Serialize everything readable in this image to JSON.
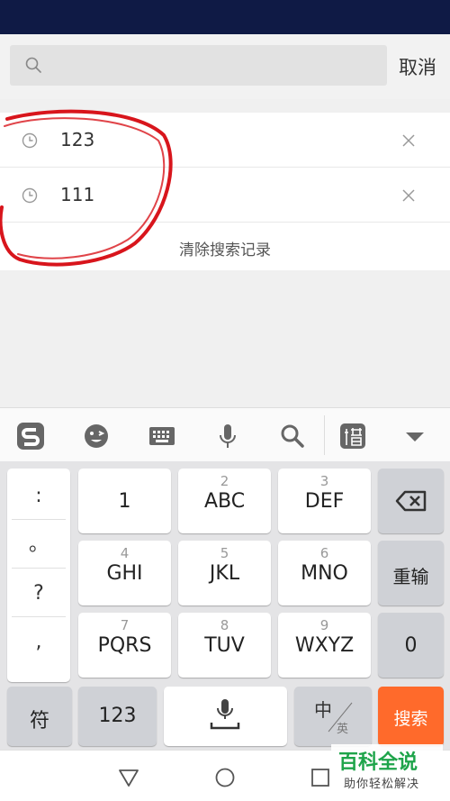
{
  "search": {
    "placeholder": "",
    "cancel_label": "取消"
  },
  "history": {
    "items": [
      {
        "text": "123"
      },
      {
        "text": "111"
      }
    ],
    "clear_label": "清除搜索记录"
  },
  "keyboard": {
    "toolbar_icons": [
      "sogou-logo-icon",
      "emoji-icon",
      "keyboard-icon",
      "microphone-icon",
      "search-icon",
      "clipboard-icon",
      "collapse-icon"
    ],
    "punctuation": [
      ":",
      "。",
      "?",
      ","
    ],
    "keys_row1": [
      {
        "num": "",
        "label": "1"
      },
      {
        "num": "2",
        "label": "ABC"
      },
      {
        "num": "3",
        "label": "DEF"
      }
    ],
    "keys_row2": [
      {
        "num": "4",
        "label": "GHI"
      },
      {
        "num": "5",
        "label": "JKL"
      },
      {
        "num": "6",
        "label": "MNO"
      }
    ],
    "keys_row3": [
      {
        "num": "7",
        "label": "PQRS"
      },
      {
        "num": "8",
        "label": "TUV"
      },
      {
        "num": "9",
        "label": "WXYZ"
      }
    ],
    "retype_label": "重输",
    "zero_label": "0",
    "symbol_label": "符",
    "num_mode_label": "123",
    "lang_zh": "中",
    "lang_en": "英",
    "search_key_label": "搜索"
  },
  "watermark": {
    "title": "百科全说",
    "subtitle": "助你轻松解决"
  },
  "colors": {
    "accent": "#ff6a2b",
    "status_bar": "#0f1a45",
    "annotation": "#d8151c",
    "watermark": "#1ea44a"
  }
}
